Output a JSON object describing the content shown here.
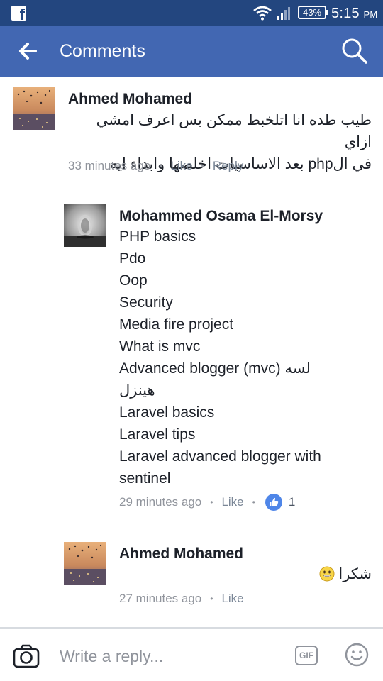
{
  "status_bar": {
    "battery": "43%",
    "time": "5:15",
    "ampm": "PM",
    "app_icon_letter": "f"
  },
  "header": {
    "title": "Comments"
  },
  "comments": [
    {
      "author": "Ahmed Mohamed",
      "lines": [
        "طيب طده انا اتلخبط ممكن بس اعرف امشي ازاي",
        "في الphp بعد الاساسيات اخلصها وابداء ايه"
      ],
      "time": "33 minutes ago",
      "like_label": "Like",
      "reply_label": "Reply"
    },
    {
      "author": "Mohammed Osama El-Morsy",
      "lines": [
        "PHP basics",
        "Pdo",
        "Oop",
        "Security",
        "Media fire project",
        "What is mvc",
        "Advanced blogger (mvc) لسه",
        "هينزل",
        "Laravel basics",
        "Laravel tips",
        "Laravel advanced blogger with",
        "sentinel"
      ],
      "time": "29 minutes ago",
      "like_label": "Like",
      "reaction_count": "1"
    },
    {
      "author": "Ahmed Mohamed",
      "text": "شكرا",
      "time": "27 minutes ago",
      "like_label": "Like"
    }
  ],
  "composer": {
    "placeholder": "Write a reply...",
    "gif_label": "GIF"
  },
  "icons": {
    "back": "arrow-left-icon",
    "search": "search-icon",
    "camera": "camera-icon",
    "gif": "gif-icon",
    "smiley": "smiley-icon",
    "like_badge": "thumbs-up-icon"
  },
  "colors": {
    "header": "#4267b2",
    "status_bar": "#23467f",
    "meta": "#90949c",
    "like_badge": "#4f86e8"
  }
}
